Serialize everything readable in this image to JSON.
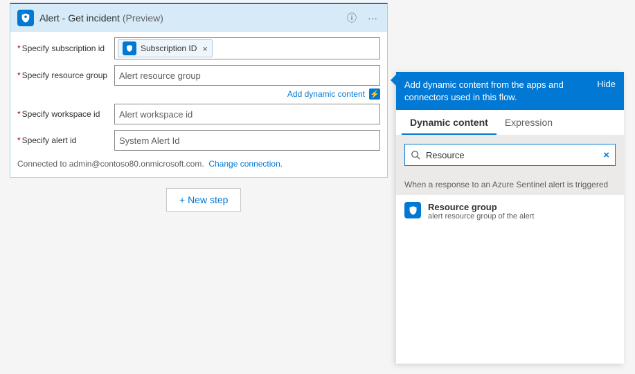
{
  "card": {
    "title": "Alert - Get incident",
    "preview": "(Preview)",
    "fields": {
      "subscription": {
        "label": "Specify subscription id",
        "token": "Subscription ID"
      },
      "resourceGroup": {
        "label": "Specify resource group",
        "value": "Alert resource group"
      },
      "workspace": {
        "label": "Specify workspace id",
        "value": "Alert workspace id"
      },
      "alertId": {
        "label": "Specify alert id",
        "value": "System Alert Id"
      }
    },
    "dynamicLink": "Add dynamic content",
    "connectedTo": "Connected to admin@contoso80.onmicrosoft.com.",
    "changeConnection": "Change connection."
  },
  "newStep": "+ New step",
  "panel": {
    "headerText": "Add dynamic content from the apps and connectors used in this flow.",
    "hide": "Hide",
    "tabs": {
      "dynamic": "Dynamic content",
      "expression": "Expression"
    },
    "searchValue": "Resource",
    "sectionTitle": "When a response to an Azure Sentinel alert is triggered",
    "result": {
      "title": "Resource group",
      "sub": "alert resource group of the alert"
    }
  }
}
